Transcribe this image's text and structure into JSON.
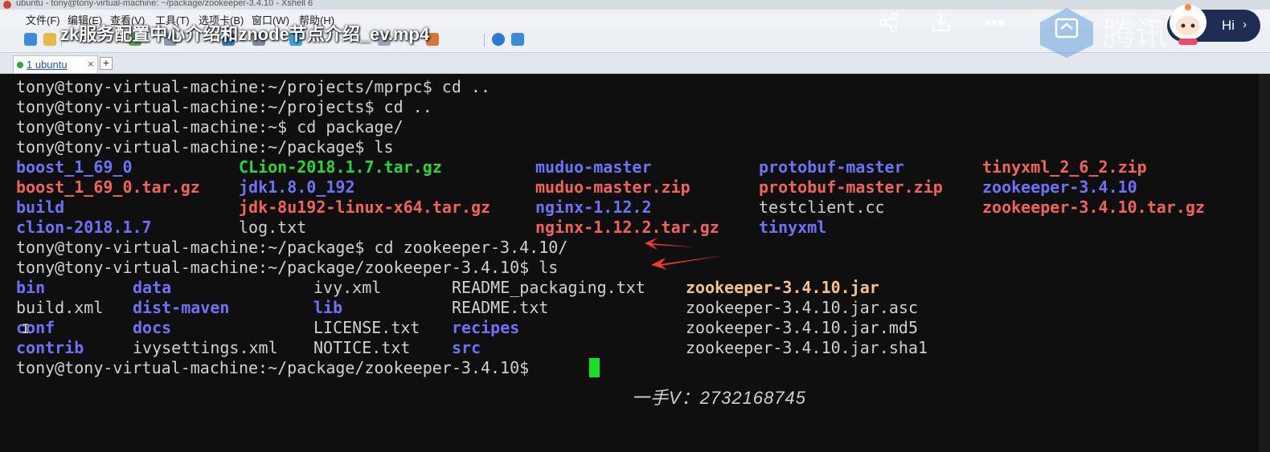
{
  "window": {
    "title": "ubuntu - tony@tony-virtual-machine: ~/package/zookeeper-3.4.10 - Xshell 6"
  },
  "menu": {
    "items": [
      "文件(F)",
      "编辑(E)",
      "查看(V)",
      "工具(T)",
      "选项卡(B)",
      "窗口(W)",
      "帮助(H)"
    ]
  },
  "tabs": [
    {
      "label": "1 ubuntu",
      "close": "×"
    }
  ],
  "tab_add": "+",
  "video": {
    "title": "zk服务配置中心介绍和znode节点介绍_ev.mp4",
    "icons": [
      "share-icon",
      "download-icon",
      "more-icon",
      "cast-icon"
    ],
    "more_glyph": "•••",
    "brand": "腾讯",
    "hi_label": "Hi",
    "hi_arrow": "›"
  },
  "colors": {
    "dir": "#6f72f7",
    "archive": "#f06459",
    "jar": "#f4c28a",
    "plain": "#d0d0d0",
    "cursor": "#16e026"
  },
  "terminal": {
    "lines": [
      "tony@tony-virtual-machine:~/projects/mprpc$ cd ..",
      "tony@tony-virtual-machine:~/projects$ cd ..",
      "tony@tony-virtual-machine:~$ cd package/",
      "tony@tony-virtual-machine:~/package$ ls"
    ],
    "package_ls": [
      [
        "boost_1_69_0",
        "CLion-2018.1.7.tar.gz",
        "muduo-master",
        "protobuf-master",
        "tinyxml_2_6_2.zip"
      ],
      [
        "boost_1_69_0.tar.gz",
        "jdk1.8.0_192",
        "muduo-master.zip",
        "protobuf-master.zip",
        "zookeeper-3.4.10"
      ],
      [
        "build",
        "jdk-8u192-linux-x64.tar.gz",
        "nginx-1.12.2",
        "testclient.cc",
        "zookeeper-3.4.10.tar.gz"
      ],
      [
        "clion-2018.1.7",
        "log.txt",
        "nginx-1.12.2.tar.gz",
        "tinyxml",
        ""
      ]
    ],
    "cmd_cd": "tony@tony-virtual-machine:~/package$ cd zookeeper-3.4.10/",
    "cmd_ls": "tony@tony-virtual-machine:~/package/zookeeper-3.4.10$ ls",
    "zk_ls": [
      [
        "bin",
        "data",
        "ivy.xml",
        "README_packaging.txt",
        "zookeeper-3.4.10.jar"
      ],
      [
        "build.xml",
        "dist-maven",
        "lib",
        "README.txt",
        "zookeeper-3.4.10.jar.asc"
      ],
      [
        "conf",
        "docs",
        "LICENSE.txt",
        "recipes",
        "zookeeper-3.4.10.jar.md5"
      ],
      [
        "contrib",
        "ivysettings.xml",
        "NOTICE.txt",
        "src",
        "zookeeper-3.4.10.jar.sha1"
      ]
    ],
    "prompt_final": "tony@tony-virtual-machine:~/package/zookeeper-3.4.10$ "
  },
  "watermark": "一手V：2732168745"
}
